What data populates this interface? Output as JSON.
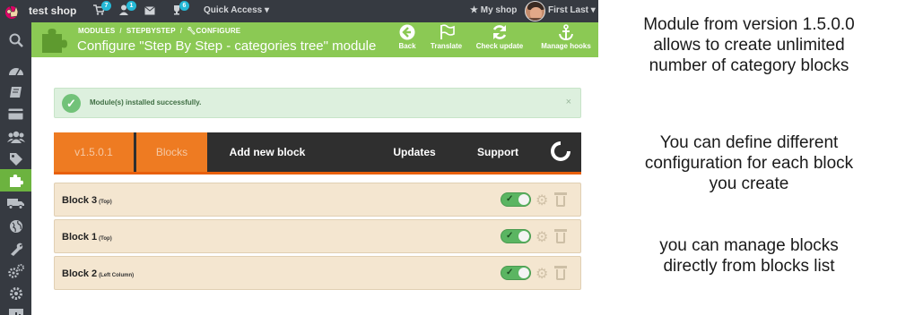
{
  "topbar": {
    "shop_name": "test shop",
    "orders_badge": "7",
    "customers_badge": "1",
    "trophy_badge": "6",
    "quick_access": "Quick Access ▾",
    "my_shop": "★ My shop",
    "user_name": "First Last ▾"
  },
  "sidebar": {
    "items": [
      "search-icon",
      "dashboard-icon",
      "catalog-icon",
      "payment-icon",
      "customers-icon",
      "tags-icon",
      "modules-icon",
      "shipping-icon",
      "localization-icon",
      "preferences-icon",
      "advanced-icon",
      "administration-icon",
      "stats-icon"
    ],
    "active": "modules-icon"
  },
  "header": {
    "breadcrumb": [
      "MODULES",
      "STEPBYSTEP",
      "CONFIGURE"
    ],
    "title": "Configure \"Step By Step - categories tree\" module",
    "buttons": {
      "back": "Back",
      "translate": "Translate",
      "check_update": "Check update",
      "manage_hooks": "Manage hooks"
    }
  },
  "alert": {
    "text": "Module(s) installed successfully.",
    "close": "×"
  },
  "tabs": {
    "version": "v1.5.0.1",
    "blocks": "Blocks",
    "add_new": "Add new block",
    "updates": "Updates",
    "support": "Support"
  },
  "blocks": [
    {
      "name": "Block 3",
      "position": "(Top)",
      "enabled": true
    },
    {
      "name": "Block 1",
      "position": "(Top)",
      "enabled": true
    },
    {
      "name": "Block 2",
      "position": "(Left Column)",
      "enabled": true
    }
  ],
  "description": {
    "p1": [
      "Module from version 1.5.0.0",
      "allows to create unlimited",
      "number of category blocks"
    ],
    "p2": [
      "You can define different",
      "configuration for each block",
      "you create"
    ],
    "p3": [
      "you can manage blocks",
      "directly from blocks list"
    ]
  },
  "colors": {
    "accent_green": "#8bc954",
    "tab_orange": "#ee7b22",
    "dark": "#363a41"
  }
}
